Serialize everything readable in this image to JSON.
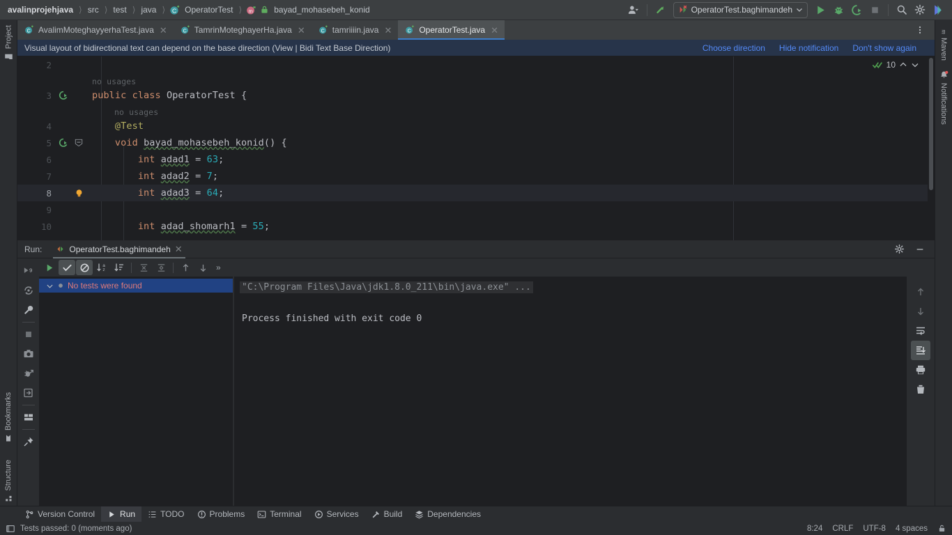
{
  "breadcrumb": {
    "items": [
      {
        "label": "avalinprojehjava",
        "icon": "",
        "bold": true
      },
      {
        "label": "src",
        "icon": "",
        "bold": false
      },
      {
        "label": "test",
        "icon": "",
        "bold": false
      },
      {
        "label": "java",
        "icon": "",
        "bold": false
      },
      {
        "label": "OperatorTest",
        "icon": "class-icon",
        "bold": false
      },
      {
        "label": "bayad_mohasebeh_konid",
        "icon": "method-icon",
        "bold": false
      }
    ]
  },
  "toolbar": {
    "account_icon": "account-icon",
    "updates_icon": "updates-arrow-icon",
    "run_config": "OperatorTest.baghimandeh",
    "run_config_icon": "test-error-icon",
    "dropdown_icon": "chevron-down-icon",
    "run_icon": "run-icon",
    "debug_icon": "debug-icon",
    "coverage_icon": "run-coverage-icon",
    "stop_icon": "stop-icon",
    "search_icon": "search-icon",
    "settings_icon": "gear-icon",
    "ai_icon": "ai-assistant-icon"
  },
  "tabs": [
    {
      "label": "AvalimMoteghayyerhaTest.java",
      "icon": "java-class-icon",
      "active": false
    },
    {
      "label": "TamrinMoteghayerHa.java",
      "icon": "java-class-icon",
      "active": false
    },
    {
      "label": "tamriiiin.java",
      "icon": "java-class-icon",
      "active": false
    },
    {
      "label": "OperatorTest.java",
      "icon": "java-class-icon",
      "active": true
    }
  ],
  "tabs_overflow_icon": "more-vertical-icon",
  "notification": {
    "message": "Visual layout of bidirectional text can depend on the base direction (View | Bidi Text Base Direction)",
    "links": [
      "Choose direction",
      "Hide notification",
      "Don't show again"
    ]
  },
  "editor": {
    "inspection_count": "10",
    "inspection_icon": "inspections-ok-icon",
    "prev_icon": "chevron-up-icon",
    "next_icon": "chevron-down-icon",
    "lines": [
      {
        "num": "2",
        "html": "",
        "gutter": "",
        "hint": "",
        "current": false
      },
      {
        "num": "",
        "html": "",
        "gutter": "",
        "hint": "no usages",
        "hint_indent": 0,
        "current": false
      },
      {
        "num": "3",
        "html": "<span class='kw'>public class</span> <span class='cls'>OperatorTest</span> <span class='pl'>{</span>",
        "gutter": "run-test-icon",
        "current": false
      },
      {
        "num": "",
        "html": "",
        "gutter": "",
        "hint": "no usages",
        "hint_indent": 1,
        "current": false
      },
      {
        "num": "4",
        "html": "    <span class='anno'>@Test</span>",
        "gutter": "",
        "current": false
      },
      {
        "num": "5",
        "html": "    <span class='kw'>void</span> <span class='fn squig'>bayad_mohasebeh_konid</span><span class='pl'>() {</span>",
        "gutter": "run-test-icon",
        "fold": "fold-collapse-icon",
        "current": false
      },
      {
        "num": "6",
        "html": "        <span class='kw'>int</span> <span class='var squig'>adad1</span> <span class='pl'>=</span> <span class='num'>63</span><span class='pl'>;</span>",
        "gutter": "",
        "current": false
      },
      {
        "num": "7",
        "html": "        <span class='kw'>int</span> <span class='var squig'>adad2</span> <span class='pl'>=</span> <span class='num'>7</span><span class='pl'>;</span>",
        "gutter": "",
        "current": false
      },
      {
        "num": "8",
        "html": "        <span class='kw'>int</span> <span class='var squig'>adad3</span> <span class='pl'>=</span> <span class='num'>64</span><span class='pl'>;</span>",
        "gutter": "intention-bulb-icon",
        "current": true
      },
      {
        "num": "9",
        "html": "",
        "gutter": "",
        "current": false
      },
      {
        "num": "10",
        "html": "        <span class='kw'>int</span> <span class='var squig'>adad_shomarh1</span> <span class='pl'>=</span> <span class='num'>55</span><span class='pl'>;</span>",
        "gutter": "",
        "current": false
      }
    ]
  },
  "run_window": {
    "label": "Run:",
    "tab_title": "OperatorTest.baghimandeh",
    "tab_icon": "rerun-tab-icon",
    "tab_close_icon": "close-icon",
    "settings_icon": "gear-icon",
    "minimize_icon": "minimize-icon",
    "left_gutter_icons": [
      "rerun-icon",
      "rerun-failed-icon",
      "wrench-icon",
      "stop-icon",
      "screenshot-icon",
      "debug-detach-icon",
      "import-tests-icon",
      "layout-icon",
      "pin-icon"
    ],
    "test_toolbar": [
      {
        "name": "rerun-tests-icon",
        "active": false
      },
      {
        "name": "show-passed-icon",
        "active": true
      },
      {
        "name": "hide-ignored-icon",
        "active": true
      },
      {
        "name": "sort-alphabetically-icon",
        "active": false
      },
      {
        "name": "sort-by-duration-icon",
        "active": false
      },
      {
        "name": "expand-all-icon",
        "active": false
      },
      {
        "name": "collapse-all-icon",
        "active": false
      },
      {
        "name": "previous-failed-icon",
        "active": false
      },
      {
        "name": "next-failed-icon",
        "active": false
      }
    ],
    "test_toolbar_more": "»",
    "tree": {
      "expander_icon": "chevron-down-icon",
      "status_icon": "test-not-found-icon",
      "label": "No tests were found",
      "label_color": "#e07b7b"
    },
    "console": {
      "command": "\"C:\\Program Files\\Java\\jdk1.8.0_211\\bin\\java.exe\" ...",
      "output": "Process finished with exit code 0"
    },
    "console_gutter_icons": [
      {
        "name": "scroll-up-icon",
        "active": false
      },
      {
        "name": "scroll-down-icon",
        "active": false
      },
      {
        "name": "soft-wrap-icon",
        "active": false
      },
      {
        "name": "scroll-to-end-icon",
        "active": true
      },
      {
        "name": "print-icon",
        "active": false
      },
      {
        "name": "clear-all-icon",
        "active": false
      }
    ]
  },
  "stripe_left": {
    "top": [
      {
        "label": "Project",
        "icon": "project-folder-icon"
      }
    ],
    "bottom": [
      {
        "label": "Bookmarks",
        "icon": "bookmark-icon"
      },
      {
        "label": "Structure",
        "icon": "structure-icon"
      }
    ]
  },
  "stripe_right": {
    "items": [
      {
        "label": "Maven",
        "icon": "maven-icon"
      },
      {
        "label": "Notifications",
        "icon": "notifications-bell-icon",
        "badge": true
      }
    ]
  },
  "bottom_bar": [
    {
      "label": "Version Control",
      "icon": "branch-icon",
      "active": false
    },
    {
      "label": "Run",
      "icon": "run-icon",
      "active": true
    },
    {
      "label": "TODO",
      "icon": "todo-list-icon",
      "active": false
    },
    {
      "label": "Problems",
      "icon": "problems-icon",
      "active": false
    },
    {
      "label": "Terminal",
      "icon": "terminal-icon",
      "active": false
    },
    {
      "label": "Services",
      "icon": "services-icon",
      "active": false
    },
    {
      "label": "Build",
      "icon": "build-hammer-icon",
      "active": false
    },
    {
      "label": "Dependencies",
      "icon": "dependencies-icon",
      "active": false
    }
  ],
  "status_bar": {
    "left_icon": "tool-window-toggle-icon",
    "message": "Tests passed: 0 (moments ago)",
    "caret_position": "8:24",
    "line_separator": "CRLF",
    "encoding": "UTF-8",
    "indent": "4 spaces",
    "lock_icon": "lock-icon"
  },
  "colors": {
    "accent_blue": "#3d7dca",
    "link_blue": "#548af7",
    "notif_bg": "#27344a",
    "error_red": "#e07b7b",
    "green": "#499c54",
    "editor_bg": "#1e1f22",
    "panel_bg": "#2b2d30"
  }
}
